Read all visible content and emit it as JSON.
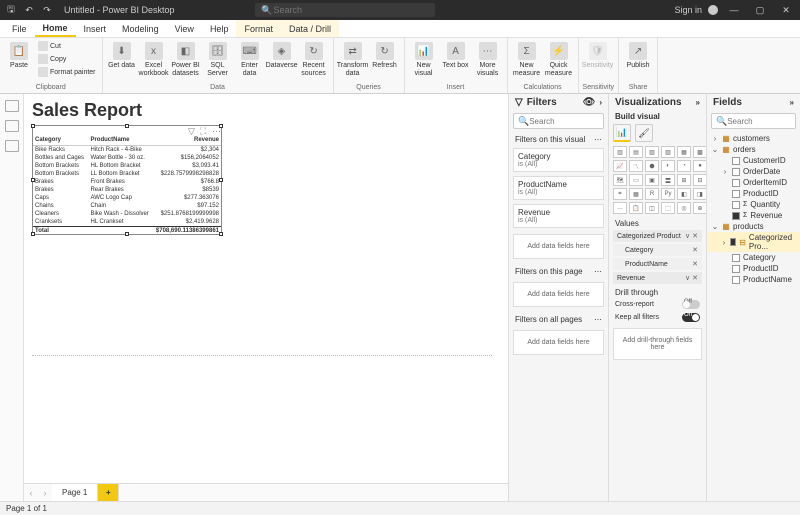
{
  "titlebar": {
    "title": "Untitled - Power BI Desktop",
    "search_placeholder": "Search",
    "signin": "Sign in"
  },
  "ribbon_tabs": [
    "File",
    "Home",
    "Insert",
    "Modeling",
    "View",
    "Help",
    "Format",
    "Data / Drill"
  ],
  "ribbon_groups": {
    "clipboard": {
      "label": "Clipboard",
      "paste": "Paste",
      "cut": "Cut",
      "copy": "Copy",
      "format_painter": "Format painter"
    },
    "data": {
      "label": "Data",
      "get_data": "Get data",
      "excel": "Excel workbook",
      "pbi_ds": "Power BI datasets",
      "sql": "SQL Server",
      "enter": "Enter data",
      "dataverse": "Dataverse",
      "recent": "Recent sources"
    },
    "queries": {
      "label": "Queries",
      "transform": "Transform data",
      "refresh": "Refresh"
    },
    "insert": {
      "label": "Insert",
      "new_visual": "New visual",
      "text_box": "Text box",
      "more": "More visuals"
    },
    "calc": {
      "label": "Calculations",
      "new_measure": "New measure",
      "quick": "Quick measure"
    },
    "sens": {
      "label": "Sensitivity",
      "item": "Sensitivity"
    },
    "share": {
      "label": "Share",
      "publish": "Publish"
    }
  },
  "report": {
    "title": "Sales Report"
  },
  "table_columns": [
    "Category",
    "ProductName",
    "Revenue"
  ],
  "table_rows": [
    {
      "c": "Bike Racks",
      "p": "Hitch Rack - 4-Bike",
      "r": "$2,304"
    },
    {
      "c": "Bottles and Cages",
      "p": "Water Bottle - 30 oz.",
      "r": "$156,2064052"
    },
    {
      "c": "Bottom Brackets",
      "p": "HL Bottom Bracket",
      "r": "$3,093.41"
    },
    {
      "c": "Bottom Brackets",
      "p": "LL Bottom Bracket",
      "r": "$228.7579998298828"
    },
    {
      "c": "Brakes",
      "p": "Front Brakes",
      "r": "$766.8"
    },
    {
      "c": "Brakes",
      "p": "Rear Brakes",
      "r": "$8539"
    },
    {
      "c": "Caps",
      "p": "AWC Logo Cap",
      "r": "$277.363076"
    },
    {
      "c": "Chains",
      "p": "Chain",
      "r": "$97.152"
    },
    {
      "c": "Cleaners",
      "p": "Bike Wash - Dissolver",
      "r": "$251.8768199999998"
    },
    {
      "c": "Cranksets",
      "p": "HL Crankset",
      "r": "$2,419.9628"
    }
  ],
  "table_total": {
    "label": "Total",
    "value": "$708,690.11386399861"
  },
  "filters": {
    "title": "Filters",
    "search_placeholder": "Search",
    "on_visual": "Filters on this visual",
    "on_page": "Filters on this page",
    "on_all": "Filters on all pages",
    "is_all": "is (All)",
    "add": "Add data fields here",
    "cards": [
      "Category",
      "ProductName",
      "Revenue"
    ]
  },
  "viz": {
    "title": "Visualizations",
    "build": "Build visual",
    "values": "Values",
    "drill": "Drill through",
    "cross": "Cross-report",
    "keep": "Keep all filters",
    "off": "Off",
    "on": "On",
    "add_drill": "Add drill-through fields here",
    "wells": {
      "hier": "Categorized Product",
      "cat": "Category",
      "pn": "ProductName",
      "rev": "Revenue"
    }
  },
  "fields": {
    "title": "Fields",
    "search_placeholder": "Search",
    "tables": {
      "customers": "customers",
      "orders": "orders",
      "products": "products"
    },
    "orders_cols": [
      "CustomerID",
      "OrderDate",
      "OrderItemID",
      "ProductID",
      "Quantity",
      "Revenue"
    ],
    "products_cols": [
      "Categorized Pro...",
      "Category",
      "ProductID",
      "ProductName"
    ]
  },
  "pages": {
    "p1": "Page 1"
  },
  "status": "Page 1 of 1"
}
